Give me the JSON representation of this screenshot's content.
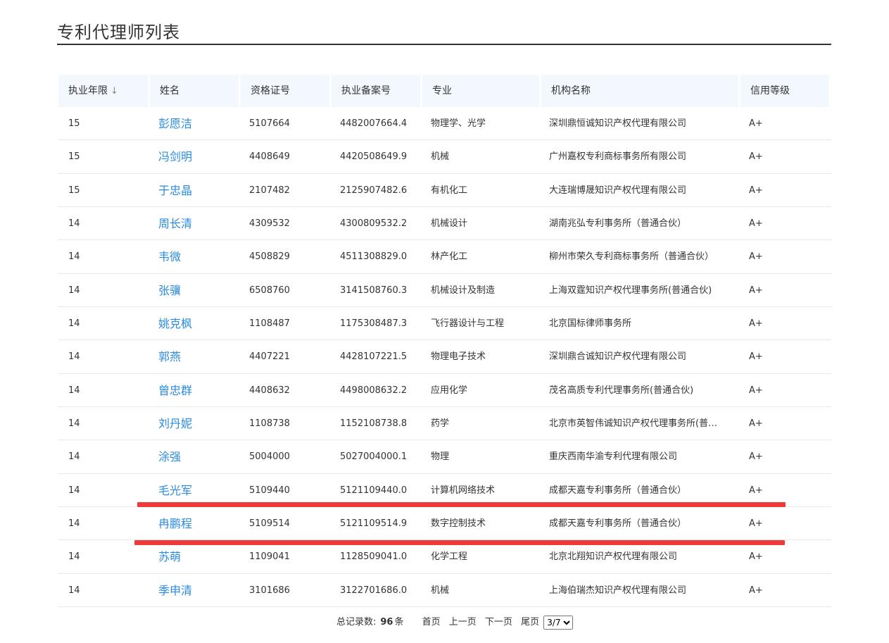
{
  "page": {
    "title": "专利代理师列表"
  },
  "table": {
    "columns": {
      "years": "执业年限",
      "name": "姓名",
      "cert_no": "资格证号",
      "record_no": "执业备案号",
      "major": "专业",
      "agency": "机构名称",
      "credit": "信用等级"
    },
    "rows": [
      {
        "years": "15",
        "name": "彭愿洁",
        "cert_no": "5107664",
        "record_no": "4482007664.4",
        "major": "物理学、光学",
        "agency": "深圳鼎恒诚知识产权代理有限公司",
        "credit": "A+"
      },
      {
        "years": "15",
        "name": "冯剑明",
        "cert_no": "4408649",
        "record_no": "4420508649.9",
        "major": "机械",
        "agency": "广州嘉权专利商标事务所有限公司",
        "credit": "A+"
      },
      {
        "years": "15",
        "name": "于忠晶",
        "cert_no": "2107482",
        "record_no": "2125907482.6",
        "major": "有机化工",
        "agency": "大连瑞博晟知识产权代理有限公司",
        "credit": "A+"
      },
      {
        "years": "14",
        "name": "周长清",
        "cert_no": "4309532",
        "record_no": "4300809532.2",
        "major": "机械设计",
        "agency": "湖南兆弘专利事务所（普通合伙）",
        "credit": "A+"
      },
      {
        "years": "14",
        "name": "韦微",
        "cert_no": "4508829",
        "record_no": "4511308829.0",
        "major": "林产化工",
        "agency": "柳州市荣久专利商标事务所（普通合伙）",
        "credit": "A+"
      },
      {
        "years": "14",
        "name": "张骥",
        "cert_no": "6508760",
        "record_no": "3141508760.3",
        "major": "机械设计及制造",
        "agency": "上海双霆知识产权代理事务所(普通合伙)",
        "credit": "A+"
      },
      {
        "years": "14",
        "name": "姚克枫",
        "cert_no": "1108487",
        "record_no": "1175308487.3",
        "major": "飞行器设计与工程",
        "agency": "北京国标律师事务所",
        "credit": "A+"
      },
      {
        "years": "14",
        "name": "郭燕",
        "cert_no": "4407221",
        "record_no": "4428107221.5",
        "major": "物理电子技术",
        "agency": "深圳鼎合诚知识产权代理有限公司",
        "credit": "A+"
      },
      {
        "years": "14",
        "name": "曾忠群",
        "cert_no": "4408632",
        "record_no": "4498008632.2",
        "major": "应用化学",
        "agency": "茂名高质专利代理事务所(普通合伙)",
        "credit": "A+"
      },
      {
        "years": "14",
        "name": "刘丹妮",
        "cert_no": "1108738",
        "record_no": "1152108738.8",
        "major": "药学",
        "agency": "北京市英智伟诚知识产权代理事务所(普…",
        "credit": "A+"
      },
      {
        "years": "14",
        "name": "涂强",
        "cert_no": "5004000",
        "record_no": "5027004000.1",
        "major": "物理",
        "agency": "重庆西南华渝专利代理有限公司",
        "credit": "A+"
      },
      {
        "years": "14",
        "name": "毛光军",
        "cert_no": "5109440",
        "record_no": "5121109440.0",
        "major": "计算机网络技术",
        "agency": "成都天嘉专利事务所（普通合伙）",
        "credit": "A+"
      },
      {
        "years": "14",
        "name": "冉鹏程",
        "cert_no": "5109514",
        "record_no": "5121109514.9",
        "major": "数字控制技术",
        "agency": "成都天嘉专利事务所（普通合伙）",
        "credit": "A+"
      },
      {
        "years": "14",
        "name": "苏萌",
        "cert_no": "1109041",
        "record_no": "1128509041.0",
        "major": "化学工程",
        "agency": "北京北翔知识产权代理有限公司",
        "credit": "A+"
      },
      {
        "years": "14",
        "name": "季申清",
        "cert_no": "3101686",
        "record_no": "3122701686.0",
        "major": "机械",
        "agency": "上海伯瑞杰知识产权代理有限公司",
        "credit": "A+"
      }
    ]
  },
  "pagination": {
    "total_label": "总记录数:",
    "total": "96",
    "unit": "条",
    "first": "首页",
    "prev": "上一页",
    "next": "下一页",
    "last": "尾页",
    "current": "3/7"
  },
  "colors": {
    "link": "#2a8be0",
    "header_bg": "#f3f8fe",
    "highlight_line": "#ee3a3a"
  },
  "icons": {
    "sort": "arrow-down-icon"
  }
}
